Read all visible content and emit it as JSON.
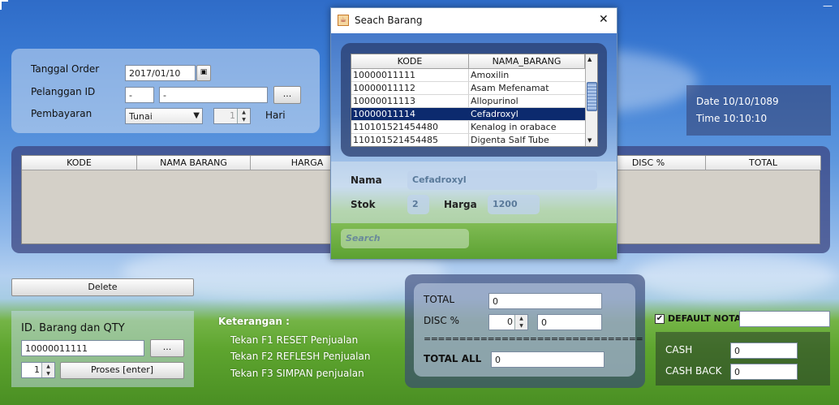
{
  "order": {
    "tanggal_label": "Tanggal Order",
    "tanggal_value": "2017/01/10",
    "pelanggan_label": "Pelanggan ID",
    "pelanggan_id": "-",
    "pelanggan_name": "-",
    "pelanggan_btn": "...",
    "pembayaran_label": "Pembayaran",
    "pembayaran_value": "Tunai",
    "hari_value": "1",
    "hari_label": "Hari"
  },
  "datetime": {
    "date": "Date 10/10/1089",
    "time": "Time 10:10:10"
  },
  "main_table": {
    "columns": [
      "KODE",
      "NAMA BARANG",
      "HARGA",
      "",
      "",
      "",
      "DISC %",
      "TOTAL"
    ]
  },
  "delete_label": "Delete",
  "entry": {
    "title": "ID. Barang dan QTY",
    "id_value": "10000011111",
    "btn": "...",
    "qty": "1",
    "proses_label": "Proses   [enter]"
  },
  "keterangan": {
    "title": "Keterangan :",
    "lines": [
      "Tekan F1  RESET Penjualan",
      "Tekan F2  REFLESH Penjualan",
      "Tekan F3  SIMPAN penjualan"
    ]
  },
  "totals": {
    "total_label": "TOTAL",
    "total_value": "0",
    "disc_label": "DISC %",
    "disc_pct": "0",
    "disc_value": "0",
    "separator": "===============================",
    "total_all_label": "TOTAL ALL",
    "total_all_value": "0"
  },
  "nota": {
    "label": "DEFAULT NOTA",
    "checked": true,
    "value": ""
  },
  "cash": {
    "cash_label": "CASH",
    "cash_value": "0",
    "cashback_label": "CASH BACK",
    "cashback_value": "0"
  },
  "dialog": {
    "title": "Seach Barang",
    "close": "✕",
    "columns": [
      "KODE",
      "NAMA_BARANG"
    ],
    "rows": [
      {
        "kode": "10000011111",
        "nama": "Amoxilin"
      },
      {
        "kode": "10000011112",
        "nama": "Asam Mefenamat"
      },
      {
        "kode": "10000011113",
        "nama": "Allopurinol"
      },
      {
        "kode": "10000011114",
        "nama": "Cefadroxyl",
        "selected": true
      },
      {
        "kode": "110101521454480",
        "nama": "Kenalog in orabace"
      },
      {
        "kode": "110101521454485",
        "nama": "Digenta Salf Tube"
      }
    ],
    "nama_label": "Nama",
    "nama_value": "Cefadroxyl",
    "stok_label": "Stok",
    "stok_value": "2",
    "harga_label": "Harga",
    "harga_value": "1200",
    "search_placeholder": "Search"
  }
}
